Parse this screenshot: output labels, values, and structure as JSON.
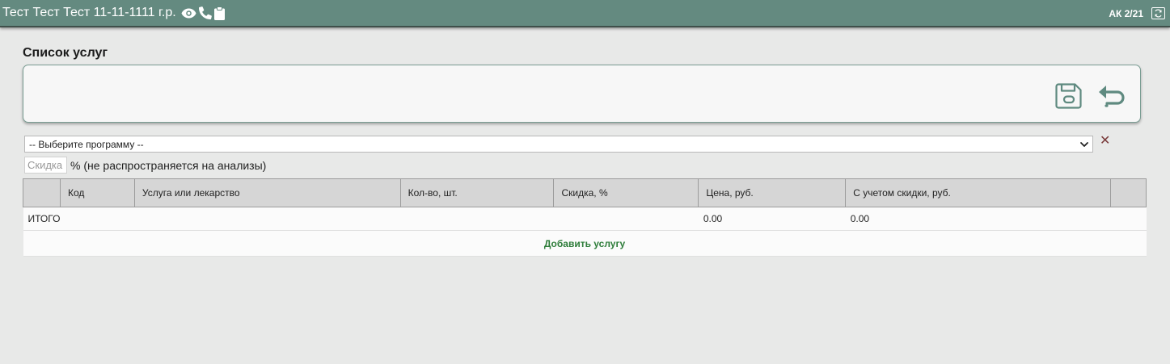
{
  "header": {
    "patient_name": "Тест Тест Тест 11-11-1111 г.р.",
    "icons": [
      "eye-icon",
      "phone-icon",
      "clipboard-icon"
    ],
    "ak_label": "АК 2/21",
    "refresh_icon": "refresh-icon",
    "bar_color": "#648a80"
  },
  "page": {
    "title": "Список услуг"
  },
  "toolbar": {
    "save_icon": "save-icon",
    "back_icon": "undo-arrow-icon"
  },
  "program_select": {
    "selected": "-- Выберите программу --",
    "clear_label": "✕"
  },
  "discount": {
    "placeholder": "Скидка",
    "value": "",
    "note": "% (не распространяется на анализы)"
  },
  "table": {
    "headers": [
      "",
      "Код",
      "Услуга или лекарство",
      "Кол-во, шт.",
      "Скидка, %",
      "Цена, руб.",
      "С учетом скидки, руб.",
      ""
    ],
    "total": {
      "label": "ИТОГО",
      "price": "0.00",
      "discounted": "0.00"
    },
    "add_label": "Добавить услугу"
  },
  "colors": {
    "accent_green": "#2e7d3a",
    "page_bg": "#e8e9e8"
  }
}
